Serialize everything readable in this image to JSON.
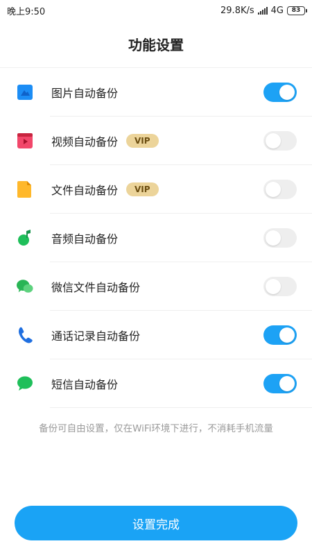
{
  "status_bar": {
    "time": "晚上9:50",
    "network_speed": "29.8K/s",
    "network_type": "4G",
    "battery": "83"
  },
  "header": {
    "title": "功能设置"
  },
  "settings": [
    {
      "label": "图片自动备份",
      "vip": "",
      "enabled": true,
      "icon": "image-icon",
      "color": "#1c8df5"
    },
    {
      "label": "视频自动备份",
      "vip": "VIP",
      "enabled": false,
      "icon": "video-icon",
      "color": "#f2476a"
    },
    {
      "label": "文件自动备份",
      "vip": "VIP",
      "enabled": false,
      "icon": "file-icon",
      "color": "#ffb82b"
    },
    {
      "label": "音频自动备份",
      "vip": "",
      "enabled": false,
      "icon": "music-note-icon",
      "color": "#1fbf5a"
    },
    {
      "label": "微信文件自动备份",
      "vip": "",
      "enabled": false,
      "icon": "wechat-icon",
      "color": "#29b555"
    },
    {
      "label": "通话记录自动备份",
      "vip": "",
      "enabled": true,
      "icon": "phone-icon",
      "color": "#1f6fe0"
    },
    {
      "label": "短信自动备份",
      "vip": "",
      "enabled": true,
      "icon": "sms-icon",
      "color": "#1fbf5a"
    }
  ],
  "hint_text": "备份可自由设置，仅在WiFi环境下进行，不消耗手机流量",
  "primary_button": {
    "label": "设置完成"
  },
  "colors": {
    "accent": "#1aa3f5",
    "toggle_off": "#eeeeee",
    "vip_bg": "#ecd49a"
  }
}
